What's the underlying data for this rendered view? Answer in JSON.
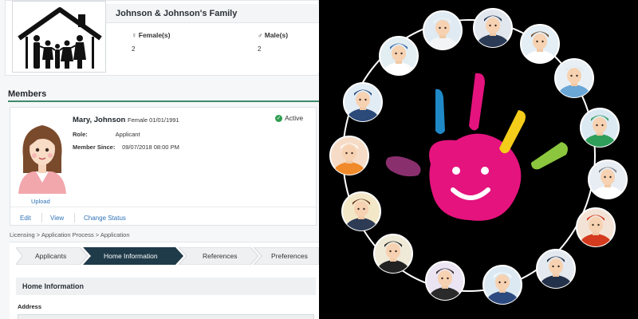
{
  "family": {
    "name": "Johnson & Johnson's Family",
    "female_label": "Female(s)",
    "female_count": "2",
    "male_label": "Male(s)",
    "male_count": "2"
  },
  "members": {
    "section_title": "Members",
    "member": {
      "name": "Mary, Johnson",
      "gender": "Female",
      "dob": "01/01/1991",
      "status": "Active",
      "role_label": "Role:",
      "role_value": "Applicant",
      "since_label": "Member Since:",
      "since_value": "09/07/2018 08:00 PM",
      "upload": "Upload"
    },
    "actions": [
      "Edit",
      "View",
      "Change Status"
    ]
  },
  "breadcrumb": "Licensing  >  Application Process  >  Application",
  "wizard": {
    "steps": [
      "Applicants",
      "Home Information",
      "References",
      "Preferences"
    ],
    "active_step": 1,
    "section_title": "Home Information",
    "address_label": "Address"
  },
  "colors": {
    "accent_green": "#3d8a6d",
    "active_step": "#1f3b4a",
    "link_blue": "#2f73b8",
    "status_green": "#2e9e4f",
    "hand_pink": "#e5137e",
    "finger_blue": "#1f89c7",
    "finger_yellow": "#f4cc1a",
    "finger_green": "#8cc63e",
    "finger_purple": "#8a2f6e"
  },
  "icons": {
    "family_logo": "house-family-icon",
    "female": "female-icon",
    "male": "male-icon",
    "status": "check-circle-icon"
  },
  "profession_avatars": [
    {
      "name": "pilot",
      "bg": "#dfeaf2",
      "hat": "#f2f4f6",
      "uniform": "#f2f4f6"
    },
    {
      "name": "captain",
      "bg": "#e2e7ee",
      "hat": "#2b3a55",
      "uniform": "#2b3a55"
    },
    {
      "name": "doctor",
      "bg": "#e3eef5",
      "hat": "#6b4a2e",
      "uniform": "#ffffff"
    },
    {
      "name": "surgeon-mask",
      "bg": "#e8f0f6",
      "hat": "#dfe7ee",
      "uniform": "#6aa6d6"
    },
    {
      "name": "surgeon",
      "bg": "#dbe9f3",
      "hat": "#2e9e5a",
      "uniform": "#2e9e5a"
    },
    {
      "name": "physician",
      "bg": "#e7edf3",
      "hat": "#7a7a7a",
      "uniform": "#ffffff"
    },
    {
      "name": "firefighter",
      "bg": "#f3e3d6",
      "hat": "#d43a1e",
      "uniform": "#d43a1e"
    },
    {
      "name": "police",
      "bg": "#e4e9ef",
      "hat": "#24314a",
      "uniform": "#24314a"
    },
    {
      "name": "sailor",
      "bg": "#dce9f2",
      "hat": "#ffffff",
      "uniform": "#2d4a80"
    },
    {
      "name": "butler",
      "bg": "#ebe4f2",
      "hat": "#3a2b2b",
      "uniform": "#2a2a2a"
    },
    {
      "name": "waitress",
      "bg": "#efe9d8",
      "hat": "#2a2a2a",
      "uniform": "#222222"
    },
    {
      "name": "businesswoman",
      "bg": "#f2e7c7",
      "hat": "#6b3a1e",
      "uniform": "#2d3b55"
    },
    {
      "name": "chef",
      "bg": "#f6dcc6",
      "hat": "#ffffff",
      "uniform": "#f08a2a"
    },
    {
      "name": "stewardess",
      "bg": "#e2ecf5",
      "hat": "#2b4a7a",
      "uniform": "#2b4a7a"
    },
    {
      "name": "flight-attendant",
      "bg": "#e3eef3",
      "hat": "#3a6aa6",
      "uniform": "#ffffff"
    }
  ]
}
